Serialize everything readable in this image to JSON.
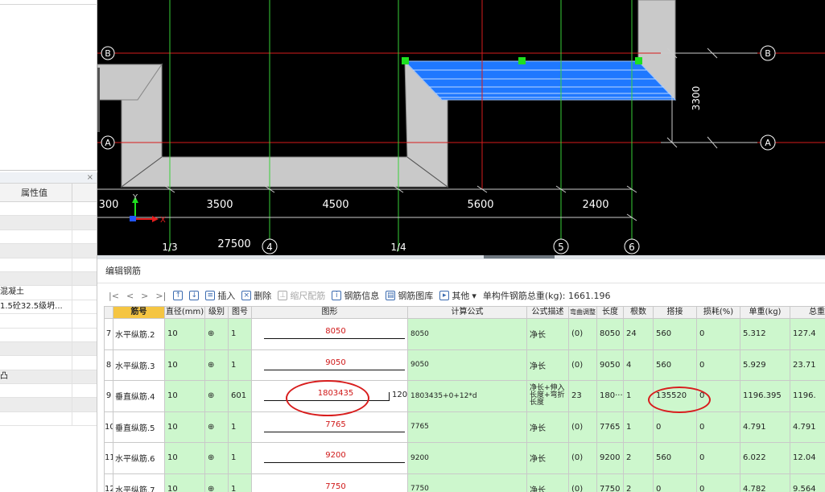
{
  "colors": {
    "cad_bg": "#000000",
    "grid_red": "#d61b1b",
    "grid_green": "#39d039",
    "slab_blue": "#1f78ff",
    "wall_gray": "#c9c9c9",
    "row_green": "#cdf7cd",
    "header_highlight": "#f5c542",
    "annotation_red": "#d81d1d"
  },
  "properties_panel": {
    "close_label": "×",
    "header_value": "属性值",
    "rows": [
      "",
      "",
      "",
      "",
      "",
      "",
      "混凝土",
      "1.5砼32.5级坍...",
      "",
      "",
      "",
      "",
      "凸",
      "",
      "",
      ""
    ]
  },
  "cad": {
    "axis_labels_letters": [
      "B",
      "A",
      "B",
      "A"
    ],
    "dimension_vertical": "3300",
    "dimensions": [
      "300",
      "3500",
      "4500",
      "5600",
      "2400"
    ],
    "total_dimension": "27500",
    "axis_labels_bottom": [
      "1/3",
      "4",
      "1/4",
      "5",
      "6"
    ],
    "origin_y": "Y",
    "origin_x": "X"
  },
  "editor": {
    "title": "编辑钢筋",
    "toolbar": {
      "nav": [
        "|<",
        "<",
        ">",
        ">|"
      ],
      "insert": "插入",
      "delete": "删除",
      "ruler": "缩尺配筋",
      "info": "钢筋信息",
      "library": "钢筋图库",
      "other": "其他",
      "total_label": "单构件钢筋总重(kg): 1661.196",
      "icons": [
        "move-up-icon",
        "move-down-icon",
        "insert-icon",
        "delete-icon",
        "ruler-icon",
        "info-icon",
        "library-icon",
        "other-icon"
      ]
    },
    "columns": [
      "",
      "筋号",
      "直径(mm)",
      "级别",
      "图号",
      "图形",
      "计算公式",
      "公式描述",
      "弯曲调整",
      "长度",
      "根数",
      "搭接",
      "损耗(%)",
      "单重(kg)",
      "总重"
    ],
    "rows": [
      {
        "no": "7",
        "name": "水平纵筋.2",
        "dia": "10",
        "grade": "⊕",
        "fig": "1",
        "shape": "8050",
        "hook": "",
        "formula": "8050",
        "desc": "净长",
        "bend": "(0)",
        "length": "8050",
        "count": "24",
        "lap": "560",
        "loss": "0",
        "unit": "5.312",
        "total": "127.4"
      },
      {
        "no": "8",
        "name": "水平纵筋.3",
        "dia": "10",
        "grade": "⊕",
        "fig": "1",
        "shape": "9050",
        "hook": "",
        "formula": "9050",
        "desc": "净长",
        "bend": "(0)",
        "length": "9050",
        "count": "4",
        "lap": "560",
        "loss": "0",
        "unit": "5.929",
        "total": "23.71"
      },
      {
        "no": "9",
        "name": "垂直纵筋.4",
        "dia": "10",
        "grade": "⊕",
        "fig": "601",
        "shape": "1803435",
        "hook": "120",
        "formula": "1803435+0+12*d",
        "desc": "净长+伸入长度+弯折长度",
        "bend": "23",
        "length": "180···",
        "count": "1",
        "lap": "135520",
        "loss": "0",
        "unit": "1196.395",
        "total": "1196."
      },
      {
        "no": "10",
        "name": "垂直纵筋.5",
        "dia": "10",
        "grade": "⊕",
        "fig": "1",
        "shape": "7765",
        "hook": "",
        "formula": "7765",
        "desc": "净长",
        "bend": "(0)",
        "length": "7765",
        "count": "1",
        "lap": "0",
        "loss": "0",
        "unit": "4.791",
        "total": "4.791"
      },
      {
        "no": "11",
        "name": "水平纵筋.6",
        "dia": "10",
        "grade": "⊕",
        "fig": "1",
        "shape": "9200",
        "hook": "",
        "formula": "9200",
        "desc": "净长",
        "bend": "(0)",
        "length": "9200",
        "count": "2",
        "lap": "560",
        "loss": "0",
        "unit": "6.022",
        "total": "12.04"
      },
      {
        "no": "12",
        "name": "水平纵筋.7",
        "dia": "10",
        "grade": "⊕",
        "fig": "1",
        "shape": "7750",
        "hook": "",
        "formula": "7750",
        "desc": "净长",
        "bend": "(0)",
        "length": "7750",
        "count": "2",
        "lap": "0",
        "loss": "0",
        "unit": "4.782",
        "total": "9.564"
      }
    ]
  }
}
